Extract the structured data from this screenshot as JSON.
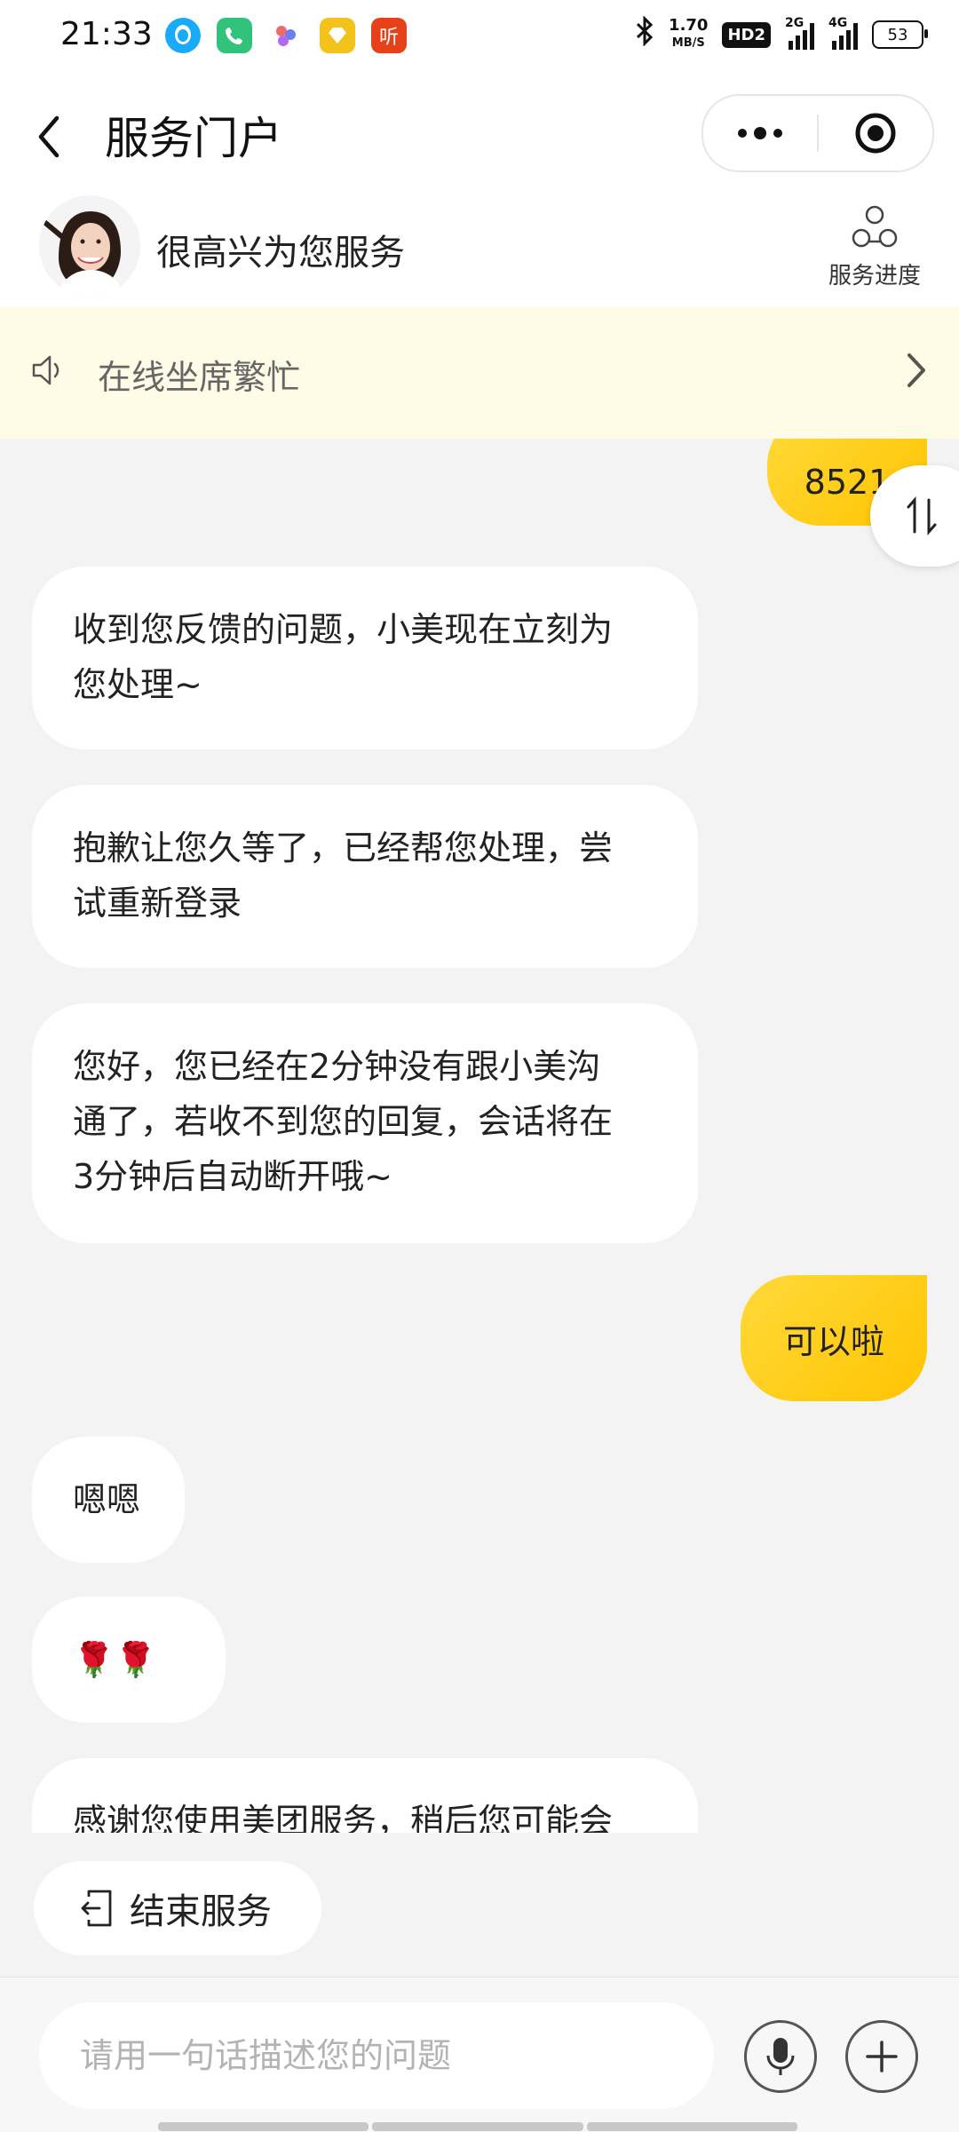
{
  "status_bar": {
    "time": "21:33",
    "speed_value": "1.70",
    "speed_unit": "MB/S",
    "hd_badge": "HD2",
    "signal1": "2G",
    "signal2": "4G",
    "battery": "53",
    "app_icons": [
      "qq-icon",
      "phone-icon",
      "dots-app-icon",
      "pay-icon",
      "listen-icon"
    ],
    "listen_char": "听"
  },
  "header": {
    "title": "服务门户"
  },
  "agent": {
    "greeting": "很高兴为您服务",
    "progress_label": "服务进度"
  },
  "notice": {
    "text": "在线坐席繁忙"
  },
  "messages": [
    {
      "side": "right",
      "text": "8521"
    },
    {
      "side": "left",
      "lines": [
        "收到您反馈的问题，小美现在立刻为",
        "您处理~"
      ]
    },
    {
      "side": "left",
      "lines": [
        "抱歉让您久等了，已经帮您处理，尝",
        "试重新登录"
      ]
    },
    {
      "side": "left",
      "lines": [
        "您好，您已经在2分钟没有跟小美沟",
        "通了，若收不到您的回复，会话将在",
        "3分钟后自动断开哦~"
      ]
    },
    {
      "side": "right",
      "text": "可以啦"
    },
    {
      "side": "left",
      "text": "嗯嗯"
    },
    {
      "side": "left",
      "text": "🌹🌹"
    },
    {
      "side": "left",
      "text": "感谢您使用美团服务，稍后您可能会"
    }
  ],
  "end_service": {
    "label": "结束服务"
  },
  "input": {
    "placeholder": "请用一句话描述您的问题"
  },
  "colors": {
    "accent": "#ffc400",
    "notice_bg": "#fefbe6",
    "chat_bg": "#f3f3f3"
  }
}
